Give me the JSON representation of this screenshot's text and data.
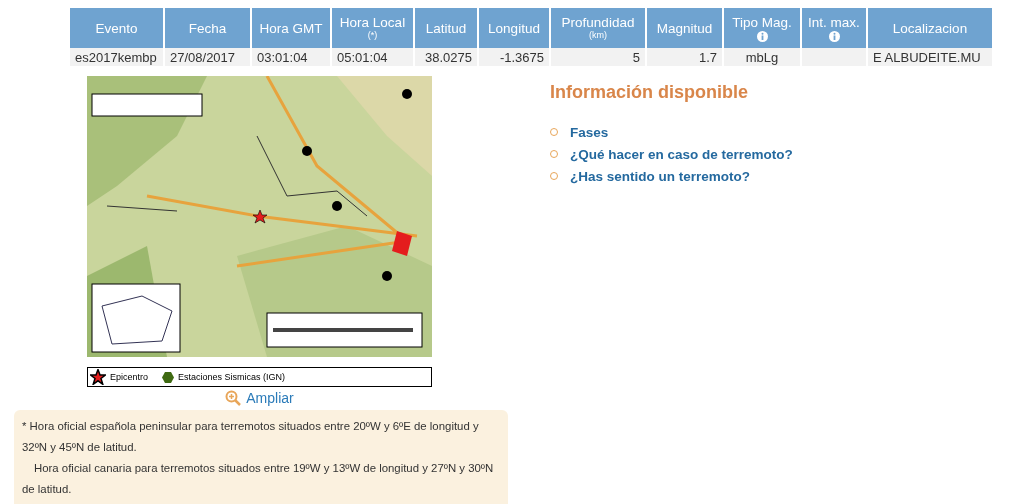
{
  "table": {
    "columns": [
      {
        "label": "Evento"
      },
      {
        "label": "Fecha"
      },
      {
        "label": "Hora GMT"
      },
      {
        "label": "Hora Local",
        "sub": "(*)"
      },
      {
        "label": "Latitud"
      },
      {
        "label": "Longitud"
      },
      {
        "label": "Profundidad",
        "sub": "(km)"
      },
      {
        "label": "Magnitud"
      },
      {
        "label": "Tipo Mag.",
        "kind": "info"
      },
      {
        "label": "Int. max.",
        "kind": "info"
      },
      {
        "label": "Localizacion"
      }
    ],
    "rows": [
      {
        "cells": [
          "es2017kembp",
          "27/08/2017",
          "03:01:04",
          "05:01:04",
          "38.0275",
          "-1.3675",
          "5",
          "1.7",
          "mbLg",
          "",
          "E ALBUDEITE.MU"
        ]
      }
    ]
  },
  "map": {
    "kind": "picture",
    "legend": [
      {
        "kind": "star",
        "label": "Epicentro"
      },
      {
        "kind": "hexagon",
        "label": "Estaciones Sismicas (IGN)"
      }
    ],
    "zoom_link": "Ampliar"
  },
  "note": [
    "* Hora oficial española peninsular para terremotos situados entre 20ºW y 6ºE de longitud y 32ºN y 45ºN de latitud.",
    "Hora oficial canaria para terremotos situados entre 19ºW y 13ºW de longitud y 27ºN y 30ºN de latitud."
  ],
  "info": {
    "title": "Información disponible",
    "links": [
      "Fases",
      "¿Qué hacer en caso de terremoto?",
      "¿Has sentido un terremoto?"
    ]
  }
}
